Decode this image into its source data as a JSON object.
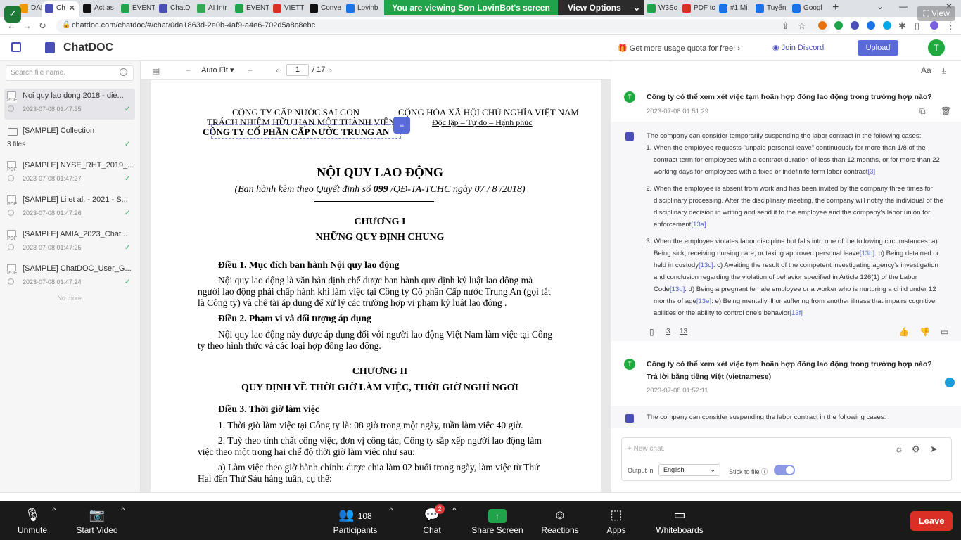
{
  "browser": {
    "tabs": [
      {
        "label": "DANC",
        "color": "#f29900"
      },
      {
        "label": "Ch",
        "color": "#4a4fb5",
        "active": true
      },
      {
        "label": "Act as",
        "color": "#111111"
      },
      {
        "label": "EVENT",
        "color": "#21a449"
      },
      {
        "label": "ChatD",
        "color": "#4a4fb5"
      },
      {
        "label": "AI Intr",
        "color": "#34a853"
      },
      {
        "label": "EVENT",
        "color": "#21a449"
      },
      {
        "label": "VIETT",
        "color": "#d93025"
      },
      {
        "label": "Conve",
        "color": "#111111"
      },
      {
        "label": "Lovinb",
        "color": "#1a73e8"
      }
    ],
    "tabs_right": [
      {
        "label": "W3Sc",
        "color": "#21a449"
      },
      {
        "label": "PDF tc",
        "color": "#d93025"
      },
      {
        "label": "#1 Mi",
        "color": "#1a73e8"
      },
      {
        "label": "Tuyển",
        "color": "#1a73e8"
      },
      {
        "label": "Googl",
        "color": "#1a73e8"
      }
    ],
    "url": "chatdoc.com/chatdoc/#/chat/0da1863d-2e0b-4af9-a4e6-702d5a8c8ebc"
  },
  "zoom_banner": {
    "message": "You are viewing Sơn LovinBot's screen",
    "options": "View Options",
    "view": "View"
  },
  "app": {
    "brand": "ChatDOC",
    "quota": "Get more usage quota for free!",
    "discord": "Join Discord",
    "upload": "Upload",
    "avatar": "T"
  },
  "sidebar": {
    "search_placeholder": "Search file name.",
    "files": [
      {
        "name": "Noi quy lao dong 2018 - die...",
        "date": "2023-07-08 01:47:35",
        "selected": true
      },
      {
        "name": "[SAMPLE] Collection",
        "date": "3 files",
        "folder": true
      },
      {
        "name": "[SAMPLE] NYSE_RHT_2019_...",
        "date": "2023-07-08 01:47:27"
      },
      {
        "name": "[SAMPLE] Li et al. - 2021 - S...",
        "date": "2023-07-08 01:47:26"
      },
      {
        "name": "[SAMPLE] AMIA_2023_Chat...",
        "date": "2023-07-08 01:47:25"
      },
      {
        "name": "[SAMPLE] ChatDOC_User_G...",
        "date": "2023-07-08 01:47:24"
      }
    ],
    "no_more": "No more."
  },
  "pdf_toolbar": {
    "fit": "Auto Fit",
    "page": "1",
    "total": "/ 17"
  },
  "pdf": {
    "company_line1": "CÔNG TY CẤP NƯỚC SÀI GÒN",
    "company_line2": "TRÁCH NHIỆM HỮU HẠN MỘT THÀNH VIÊN",
    "company_line3": "CÔNG TY CỔ PHẦN CẤP NƯỚC TRUNG AN",
    "nation_line1": "CỘNG HÒA XÃ HỘI CHỦ NGHĨA VIỆT NAM",
    "nation_line2": "Độc lập – Tự do – Hạnh phúc",
    "title": "NỘI QUY LAO ĐỘNG",
    "subtitle_pre": "(Ban hành kèm theo Quyết định số",
    "subtitle_num": "099",
    "subtitle_post": "/QĐ-TA-TCHC ngày  07 / 8 /2018)",
    "ch1": "CHƯƠNG I",
    "ch1_title": "NHỮNG QUY ĐỊNH CHUNG",
    "art1": "Điều 1. Mục đích ban hành Nội quy lao động",
    "art1_p1": "Nội quy lao động là văn bản định chế được ban hành quy định kỷ luật lao động mà",
    "art1_p2": "người lao động phải chấp hành khi làm việc tại Công ty Cổ phần Cấp nước Trung An (gọi tắt",
    "art1_p3": "là Công ty) và chế tài áp dụng để xử lý các trường hợp vi phạm kỷ luật lao động .",
    "art2": "Điều 2. Phạm vi và đối tượng áp dụng",
    "art2_p1": "Nội quy lao động này được áp dụng đối với người lao động Việt Nam làm việc tại Công",
    "art2_p2": "ty theo hình thức và các loại hợp đồng lao động.",
    "ch2": "CHƯƠNG II",
    "ch2_title": "QUY ĐỊNH VỀ THỜI GIỜ LÀM VIỆC, THỜI GIỜ NGHỈ NGƠI",
    "art3": "Điều 3. Thời giờ làm việc",
    "art3_1": "1.  Thời giờ làm việc tại Công ty là: 08 giờ trong một ngày, tuần làm việc 40 giờ.",
    "art3_2a": "2.  Tuỳ theo tính chất công việc, đơn vị công tác, Công ty sắp xếp người lao động làm",
    "art3_2b": "việc theo một trong hai chế độ thời giờ làm việc như sau:",
    "art3_a1": "a)  Làm việc theo giờ hành chính: được chia làm 02 buổi trong ngày, làm việc từ Thứ",
    "art3_a2": "Hai đến Thứ Sáu hàng tuần, cụ thể:"
  },
  "chat": {
    "q1": "Công ty có thể xem xét việc tạm hoãn hợp đồng lao động trong trường hợp nào?",
    "q1_date": "2023-07-08 01:51:29",
    "a1_intro": "The company can consider temporarily suspending the labor contract in the following cases:",
    "a1_item1": "When the employee requests \"unpaid personal leave\" continuously for more than 1/8 of the contract term for employees with a contract duration of less than 12 months, or for more than 22 working days for employees with a fixed or indefinite term labor contract",
    "a1_item1_ref": "[3]",
    "a1_item2": "When the employee is absent from work and has been invited by the company three times for disciplinary processing. After the disciplinary meeting, the company will notify the individual of the disciplinary decision in writing and send it to the employee and the company's labor union for enforcement",
    "a1_item2_ref": "[13a]",
    "a1_item3_a": "When the employee violates labor discipline but falls into one of the following circumstances: a) Being sick, receiving nursing care, or taking approved personal leave",
    "a1_item3_ref_b": "[13b]",
    "a1_item3_b": ". b) Being detained or held in custody",
    "a1_item3_ref_c": "[13c]",
    "a1_item3_c": ". c) Awaiting the result of the competent investigating agency's investigation and conclusion regarding the violation of behavior specified in Article 126(1) of the Labor Code",
    "a1_item3_ref_d": "[13d]",
    "a1_item3_d": ". d) Being a pregnant female employee or a worker who is nurturing a child under 12 months of age",
    "a1_item3_ref_e": "[13e]",
    "a1_item3_e": ". e) Being mentally ill or suffering from another illness that impairs cognitive abilities or the ability to control one's behavior",
    "a1_item3_ref_f": "[13f]",
    "a1_pages": [
      "3",
      "13"
    ],
    "q2": "Công ty có thể xem xét việc tạm hoãn hợp đồng lao động trong trường hợp nào? Trả lời bằng tiếng Việt (vietnamese)",
    "q2_date": "2023-07-08 01:52:11",
    "a2_intro": "The company can consider suspending the labor contract in the following cases:",
    "input_placeholder": "+ New chat.",
    "output_in_label": "Output in",
    "output_language": "English",
    "stick_label": "Stick to file"
  },
  "zoom": {
    "unmute": "Unmute",
    "start_video": "Start Video",
    "participants": "Participants",
    "participant_count": "108",
    "chat": "Chat",
    "chat_badge": "2",
    "share": "Share Screen",
    "reactions": "Reactions",
    "apps": "Apps",
    "whiteboards": "Whiteboards",
    "leave": "Leave"
  },
  "colors": {
    "accent": "#5a6ad8",
    "zoom_green": "#21a449",
    "leave_red": "#d93025"
  }
}
